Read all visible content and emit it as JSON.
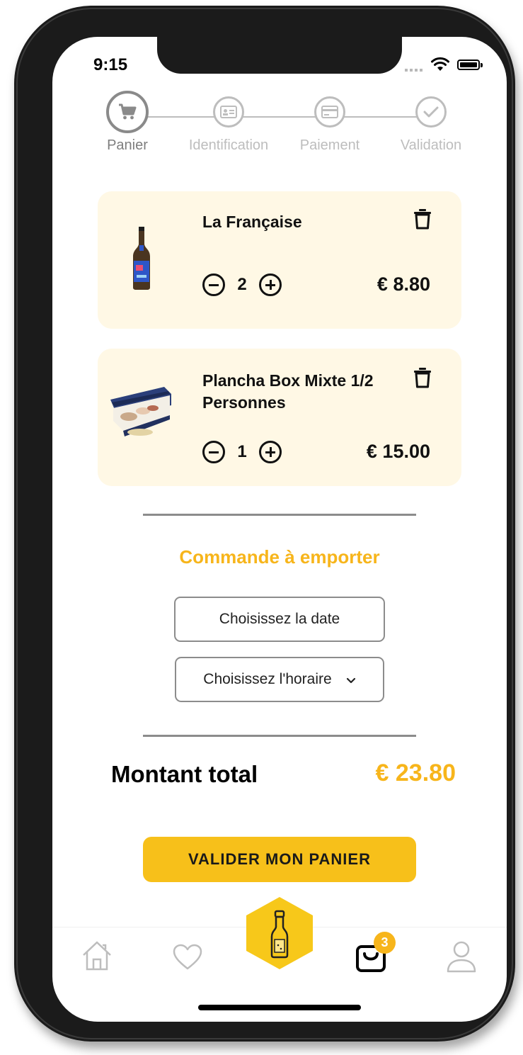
{
  "status_bar": {
    "time": "9:15"
  },
  "steps": [
    {
      "label": "Panier",
      "icon": "cart-icon",
      "active": true
    },
    {
      "label": "Identification",
      "icon": "id-card-icon",
      "active": false
    },
    {
      "label": "Paiement",
      "icon": "credit-card-icon",
      "active": false
    },
    {
      "label": "Validation",
      "icon": "check-icon",
      "active": false
    }
  ],
  "cart": {
    "items": [
      {
        "name": "La Française",
        "quantity": "2",
        "price": "€ 8.80",
        "image": "beer-bottle-image"
      },
      {
        "name": "Plancha Box Mixte 1/2 Personnes",
        "quantity": "1",
        "price": "€ 15.00",
        "image": "plancha-box-image"
      }
    ]
  },
  "pickup": {
    "title": "Commande à emporter",
    "date_button": "Choisissez la date",
    "time_select": "Choisissez l'horaire"
  },
  "summary": {
    "total_label": "Montant total",
    "total_value": "€ 23.80",
    "validate_button": "VALIDER MON PANIER"
  },
  "tabbar": {
    "items": [
      "home-icon",
      "heart-icon",
      "bottle-icon",
      "bag-icon",
      "user-icon"
    ],
    "cart_badge": "3"
  },
  "colors": {
    "accent": "#f7b51b",
    "card_bg": "#fff8e5",
    "button": "#f7c01a"
  }
}
